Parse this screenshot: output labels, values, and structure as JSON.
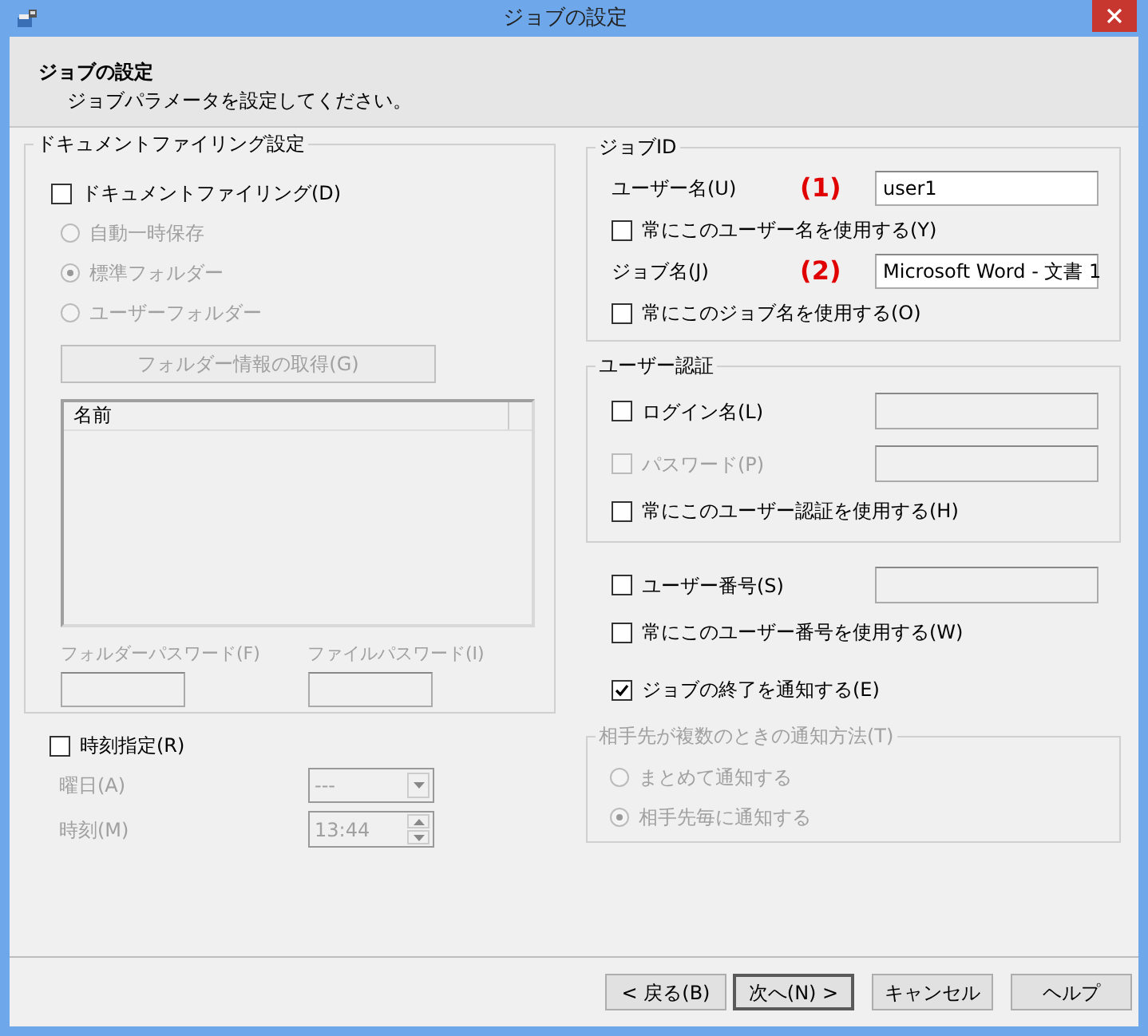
{
  "window": {
    "title": "ジョブの設定"
  },
  "header": {
    "title": "ジョブの設定",
    "subtitle": "ジョブパラメータを設定してください。"
  },
  "document_filing": {
    "legend": "ドキュメントファイリング設定",
    "checkbox": {
      "label": "ドキュメントファイリング(D)",
      "checked": false,
      "disabled": false
    },
    "radios": [
      {
        "label": "自動一時保存",
        "selected": false,
        "disabled": true
      },
      {
        "label": "標準フォルダー",
        "selected": true,
        "disabled": true
      },
      {
        "label": "ユーザーフォルダー",
        "selected": false,
        "disabled": true
      }
    ],
    "button": {
      "label": "フォルダー情報の取得(G)",
      "disabled": true
    },
    "list": {
      "columns": [
        "名前"
      ]
    },
    "password_fields": [
      {
        "label": "フォルダーパスワード(F)",
        "disabled": true
      },
      {
        "label": "ファイルパスワード(I)",
        "disabled": true
      }
    ]
  },
  "schedule": {
    "checkbox": {
      "label": "時刻指定(R)",
      "checked": false,
      "disabled": false
    },
    "fields": [
      {
        "kind": "dropdown",
        "label": "曜日(A)",
        "value": "---",
        "disabled": true
      },
      {
        "kind": "spinner",
        "label": "時刻(M)",
        "value": "13:44",
        "disabled": true
      }
    ]
  },
  "job_id": {
    "legend": "ジョブID",
    "rows": [
      {
        "kind": "field",
        "label": "ユーザー名(U)",
        "annotation": "(1)",
        "value": "user1",
        "disabled": false
      },
      {
        "kind": "checkbox",
        "label": "常にこのユーザー名を使用する(Y)",
        "checked": false,
        "disabled": false
      },
      {
        "kind": "field",
        "label": "ジョブ名(J)",
        "annotation": "(2)",
        "value": "Microsoft Word - 文書 1",
        "disabled": false
      },
      {
        "kind": "checkbox",
        "label": "常にこのジョブ名を使用する(O)",
        "checked": false,
        "disabled": false
      }
    ]
  },
  "user_auth": {
    "legend": "ユーザー認証",
    "rows": [
      {
        "kind": "checkbox_field",
        "label": "ログイン名(L)",
        "checked": false,
        "disabled": false
      },
      {
        "kind": "checkbox_field",
        "label": "パスワード(P)",
        "checked": false,
        "disabled": true
      },
      {
        "kind": "checkbox",
        "label": "常にこのユーザー認証を使用する(H)",
        "checked": false,
        "disabled": false
      }
    ]
  },
  "user_number": {
    "rows": [
      {
        "kind": "checkbox_field",
        "label": "ユーザー番号(S)",
        "checked": false,
        "disabled": false
      },
      {
        "kind": "checkbox",
        "label": "常にこのユーザー番号を使用する(W)",
        "checked": false,
        "disabled": false
      }
    ]
  },
  "notify": {
    "label": "ジョブの終了を通知する(E)",
    "checked": true,
    "disabled": false
  },
  "notify_method": {
    "legend": "相手先が複数のときの通知方法(T)",
    "disabled": true,
    "radios": [
      {
        "label": "まとめて通知する",
        "selected": false,
        "disabled": true
      },
      {
        "label": "相手先毎に通知する",
        "selected": true,
        "disabled": true
      }
    ]
  },
  "buttons": [
    {
      "label": "< 戻る(B)",
      "default": false
    },
    {
      "label": "次へ(N) >",
      "default": true
    },
    {
      "label": "キャンセル",
      "default": false
    },
    {
      "label": "ヘルプ",
      "default": false
    }
  ]
}
